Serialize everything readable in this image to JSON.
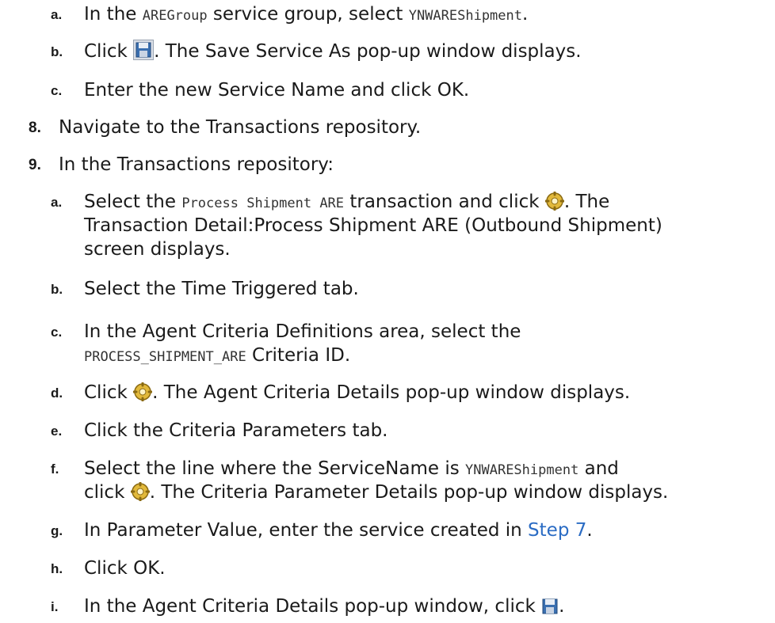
{
  "steps": {
    "s7a": {
      "label": "a.",
      "t1": "In the ",
      "code1": "AREGroup",
      "t2": " service group, select ",
      "code2": "YNWAREShipment",
      "t3": "."
    },
    "s7b": {
      "label": "b.",
      "t1": "Click ",
      "t2": ". The Save Service As pop-up window displays."
    },
    "s7c": {
      "label": "c.",
      "t1": "Enter the new Service Name and click OK."
    },
    "s8": {
      "label": "8.",
      "t1": "Navigate to the Transactions repository."
    },
    "s9": {
      "label": "9.",
      "t1": "In the Transactions repository:"
    },
    "s9a": {
      "label": "a.",
      "t1": "Select the ",
      "code1": "Process Shipment ARE",
      "t2": " transaction and click ",
      "t3": ". The",
      "line2": "Transaction Detail:Process Shipment ARE (Outbound Shipment)",
      "line3": "screen displays."
    },
    "s9b": {
      "label": "b.",
      "t1": "Select the Time Triggered tab."
    },
    "s9c": {
      "label": "c.",
      "t1": "In the Agent Criteria Definitions area, select the",
      "code1": "PROCESS_SHIPMENT_ARE",
      "t2": " Criteria ID."
    },
    "s9d": {
      "label": "d.",
      "t1": "Click ",
      "t2": ". The Agent Criteria Details pop-up window displays."
    },
    "s9e": {
      "label": "e.",
      "t1": "Click the Criteria Parameters tab."
    },
    "s9f": {
      "label": "f.",
      "t1": "Select the line where the ServiceName is ",
      "code1": "YNWAREShipment",
      "t2": " and",
      "t3": "click ",
      "t4": ". The Criteria Parameter Details pop-up window displays."
    },
    "s9g": {
      "label": "g.",
      "t1": "In Parameter Value, enter the service created in ",
      "link": "Step 7",
      "t2": "."
    },
    "s9h": {
      "label": "h.",
      "t1": "Click OK."
    },
    "s9i": {
      "label": "i.",
      "t1": "In the Agent Criteria Details pop-up window, click ",
      "t2": "."
    }
  },
  "icons": {
    "save": "save-icon",
    "details": "details-gear-icon"
  },
  "colors": {
    "link": "#2b6cc4"
  }
}
